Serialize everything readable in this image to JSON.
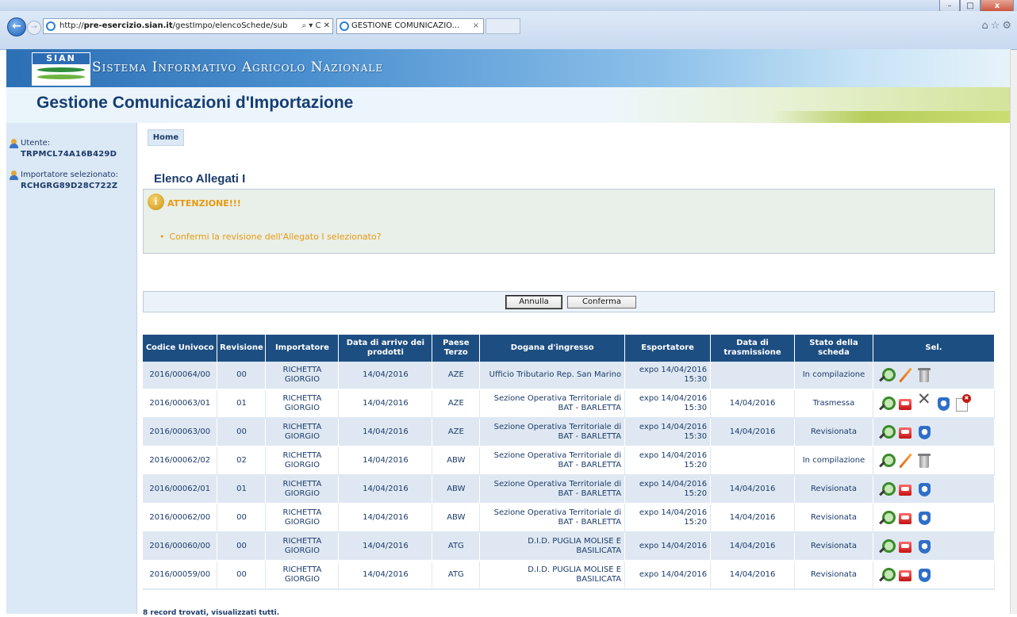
{
  "window": {
    "title": "",
    "buttons": {
      "minimize": "–",
      "maximize": "□",
      "close": "x"
    }
  },
  "browser": {
    "url": "http://pre-esercizio.sian.it/gestImpo/elencoSchede/sub",
    "url_host": "pre-esercizio.sian.it",
    "url_prefix": "http://",
    "url_path": "/gestImpo/elencoSchede/sub",
    "address_controls": "⌕ ▾ C ✕",
    "tab_title": "GESTIONE COMUNICAZIO...",
    "tab_close": "×",
    "tool_icons": "⌂☆⚙"
  },
  "header": {
    "logo_text": "SIAN",
    "system_name": "Sistema Informativo Agricolo Nazionale",
    "app_title": "Gestione Comunicazioni d'Importazione"
  },
  "sidebar": {
    "user_label": "Utente:",
    "user_value": "TRPMCL74A16B429D",
    "importer_label": "Importatore selezionato:",
    "importer_value": "RCHGRG89D28C722Z"
  },
  "nav": {
    "home": "Home"
  },
  "page": {
    "heading": "Elenco Allegati I",
    "alert_icon": "i",
    "alert_title": "ATTENZIONE!!!",
    "alert_message": "Confermi la revisione dell'Allegato I selezionato?",
    "buttons": {
      "cancel": "Annulla",
      "confirm": "Conferma"
    }
  },
  "table": {
    "columns": [
      "Codice Univoco",
      "Revisione",
      "Importatore",
      "Data di arrivo dei prodotti",
      "Paese Terzo",
      "Dogana d'ingresso",
      "Esportatore",
      "Data di trasmissione",
      "Stato della scheda",
      "Sel."
    ],
    "rows": [
      {
        "codice": "2016/00064/00",
        "revisione": "00",
        "importatore": "RICHETTA GIORGIO",
        "data_arrivo": "14/04/2016",
        "paese": "AZE",
        "dogana": "Ufficio Tributario Rep. San Marino",
        "esportatore": "expo 14/04/2016 15:30",
        "data_trasmissione": "",
        "stato": "In compilazione",
        "icons": [
          "view-icon",
          "edit-icon",
          "trash-icon"
        ]
      },
      {
        "codice": "2016/00063/01",
        "revisione": "01",
        "importatore": "RICHETTA GIORGIO",
        "data_arrivo": "14/04/2016",
        "paese": "AZE",
        "dogana": "Sezione Operativa Territoriale di BAT - BARLETTA",
        "esportatore": "expo 14/04/2016 15:30",
        "data_trasmissione": "14/04/2016",
        "stato": "Trasmessa",
        "icons": [
          "view-icon",
          "pdf-icon",
          "tools-icon",
          "disk-icon",
          "revoke-icon"
        ]
      },
      {
        "codice": "2016/00063/00",
        "revisione": "00",
        "importatore": "RICHETTA GIORGIO",
        "data_arrivo": "14/04/2016",
        "paese": "AZE",
        "dogana": "Sezione Operativa Territoriale di BAT - BARLETTA",
        "esportatore": "expo 14/04/2016 15:30",
        "data_trasmissione": "14/04/2016",
        "stato": "Revisionata",
        "icons": [
          "view-icon",
          "pdf-icon",
          "disk-icon"
        ]
      },
      {
        "codice": "2016/00062/02",
        "revisione": "02",
        "importatore": "RICHETTA GIORGIO",
        "data_arrivo": "14/04/2016",
        "paese": "ABW",
        "dogana": "Sezione Operativa Territoriale di BAT - BARLETTA",
        "esportatore": "expo 14/04/2016 15:20",
        "data_trasmissione": "",
        "stato": "In compilazione",
        "icons": [
          "view-icon",
          "edit-icon",
          "trash-icon"
        ]
      },
      {
        "codice": "2016/00062/01",
        "revisione": "01",
        "importatore": "RICHETTA GIORGIO",
        "data_arrivo": "14/04/2016",
        "paese": "ABW",
        "dogana": "Sezione Operativa Territoriale di BAT - BARLETTA",
        "esportatore": "expo 14/04/2016 15:20",
        "data_trasmissione": "14/04/2016",
        "stato": "Revisionata",
        "icons": [
          "view-icon",
          "pdf-icon",
          "disk-icon"
        ]
      },
      {
        "codice": "2016/00062/00",
        "revisione": "00",
        "importatore": "RICHETTA GIORGIO",
        "data_arrivo": "14/04/2016",
        "paese": "ABW",
        "dogana": "Sezione Operativa Territoriale di BAT - BARLETTA",
        "esportatore": "expo 14/04/2016 15:20",
        "data_trasmissione": "14/04/2016",
        "stato": "Revisionata",
        "icons": [
          "view-icon",
          "pdf-icon",
          "disk-icon"
        ]
      },
      {
        "codice": "2016/00060/00",
        "revisione": "00",
        "importatore": "RICHETTA GIORGIO",
        "data_arrivo": "14/04/2016",
        "paese": "ATG",
        "dogana": "D.I.D. PUGLIA MOLISE E BASILICATA",
        "esportatore": "expo 14/04/2016",
        "data_trasmissione": "14/04/2016",
        "stato": "Revisionata",
        "icons": [
          "view-icon",
          "pdf-icon",
          "disk-icon"
        ]
      },
      {
        "codice": "2016/00059/00",
        "revisione": "00",
        "importatore": "RICHETTA GIORGIO",
        "data_arrivo": "14/04/2016",
        "paese": "ATG",
        "dogana": "D.I.D. PUGLIA MOLISE E BASILICATA",
        "esportatore": "expo 14/04/2016",
        "data_trasmissione": "14/04/2016",
        "stato": "Revisionata",
        "icons": [
          "view-icon",
          "pdf-icon",
          "disk-icon"
        ]
      }
    ],
    "footer": "8 record trovati, visualizzati tutti."
  }
}
